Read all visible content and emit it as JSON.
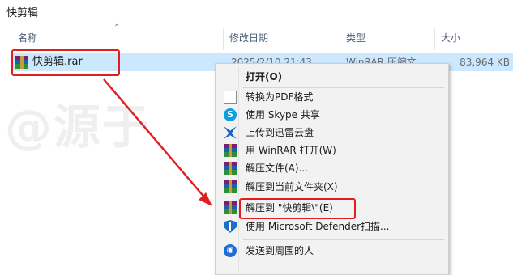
{
  "window": {
    "title": "快剪辑"
  },
  "columns": {
    "name": "名称",
    "modified": "修改日期",
    "type": "类型",
    "size": "大小"
  },
  "file": {
    "name": "快剪辑.rar",
    "modified": "2025/2/10 21:43",
    "type": "WinRAR 压缩文",
    "size": "83,964 KB"
  },
  "watermark": "@源于",
  "context_menu": {
    "items": [
      {
        "label": "打开(O)",
        "icon": "none"
      },
      {
        "label": "转换为PDF格式",
        "icon": "document-icon"
      },
      {
        "label": "使用 Skype 共享",
        "icon": "skype-icon"
      },
      {
        "label": "上传到迅雷云盘",
        "icon": "xunlei-icon"
      },
      {
        "label": "用 WinRAR 打开(W)",
        "icon": "winrar-icon"
      },
      {
        "label": "解压文件(A)...",
        "icon": "winrar-icon"
      },
      {
        "label": "解压到当前文件夹(X)",
        "icon": "winrar-icon"
      },
      {
        "label": "解压到 \"快剪辑\\\"(E)",
        "icon": "winrar-icon"
      },
      {
        "label": "使用 Microsoft Defender扫描...",
        "icon": "defender-icon"
      },
      {
        "label": "发送到周围的人",
        "icon": "share-icon"
      }
    ]
  },
  "colors": {
    "selection": "#cce8ff",
    "annotation": "#e02020",
    "menu_bg": "#f2f2f2"
  }
}
